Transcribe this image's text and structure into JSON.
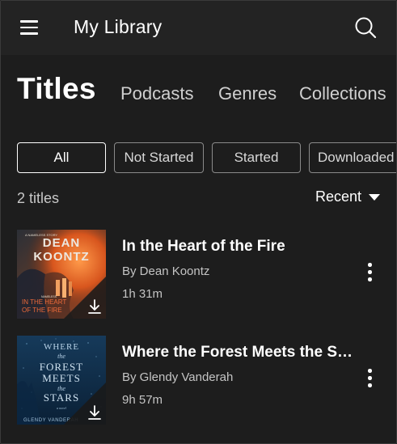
{
  "header": {
    "title": "My Library",
    "menu_icon": "hamburger-menu-icon",
    "search_icon": "search-icon"
  },
  "tabs": [
    {
      "label": "Titles",
      "active": true
    },
    {
      "label": "Podcasts",
      "active": false
    },
    {
      "label": "Genres",
      "active": false
    },
    {
      "label": "Collections",
      "active": false
    }
  ],
  "filters": [
    {
      "label": "All",
      "active": true
    },
    {
      "label": "Not Started",
      "active": false
    },
    {
      "label": "Started",
      "active": false
    },
    {
      "label": "Downloaded",
      "active": false
    }
  ],
  "summary": {
    "count_text": "2 titles",
    "sort_label": "Recent",
    "sort_icon": "caret-down-icon"
  },
  "books": [
    {
      "title": "In the Heart of the Fire",
      "author": "By Dean Koontz",
      "duration": "1h 31m",
      "downloaded": true,
      "cover": {
        "top_text": "A NAMELESS STORY",
        "author_line1": "DEAN",
        "author_line2": "KOONTZ",
        "series": "NAMELESS",
        "title_line1": "IN THE HEART",
        "title_line2": "OF THE FIRE",
        "colors": {
          "bg": "#3a2a22",
          "flame": "#e0703a",
          "text": "#ece7df"
        }
      }
    },
    {
      "title": "Where the Forest Meets the S…",
      "author": "By Glendy Vanderah",
      "duration": "9h 57m",
      "downloaded": true,
      "cover": {
        "words": [
          "WHERE",
          "the",
          "FOREST",
          "MEETS",
          "the",
          "STARS"
        ],
        "subtitle": "a novel",
        "author": "GLENDY VANDERAH",
        "colors": {
          "bg": "#0e2a44",
          "text": "#b8d3e8"
        }
      }
    }
  ],
  "icons": {
    "download": "download-icon",
    "more": "more-vertical-icon"
  }
}
